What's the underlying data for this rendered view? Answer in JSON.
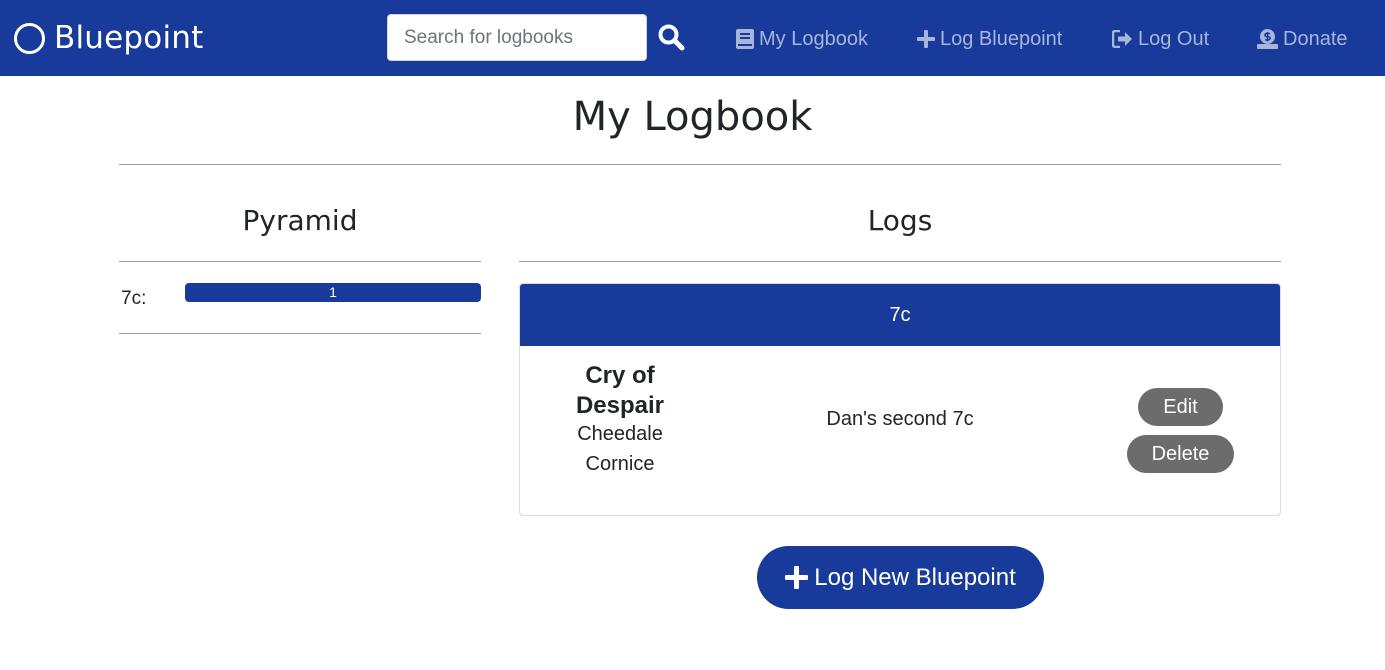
{
  "colors": {
    "brand": "#173a9b",
    "button_gray": "#6c6c6c",
    "nav_link": "#a9b5d8"
  },
  "navbar": {
    "brand": "Bluepoint",
    "brand_icon": "circle-icon",
    "search": {
      "placeholder": "Search for logbooks",
      "value": "",
      "icon": "search-icon"
    },
    "links": {
      "my_logbook": {
        "label": "My Logbook",
        "icon": "book-icon"
      },
      "log_bluepoint": {
        "label": "Log Bluepoint",
        "icon": "plus-icon"
      },
      "log_out": {
        "label": "Log Out",
        "icon": "sign-out-icon"
      },
      "donate": {
        "label": "Donate",
        "icon": "money-icon"
      }
    }
  },
  "page": {
    "title": "My Logbook"
  },
  "pyramid": {
    "title": "Pyramid",
    "rows": [
      {
        "grade": "7c:",
        "count": "1",
        "fill_fraction": 1.0
      }
    ]
  },
  "logs": {
    "title": "Logs",
    "groups": [
      {
        "grade": "7c",
        "entries": [
          {
            "route": "Cry of Despair",
            "crag": "Cheedale",
            "sector": "Cornice",
            "note": "Dan's second 7c",
            "edit_label": "Edit",
            "delete_label": "Delete"
          }
        ]
      }
    ],
    "new_button": {
      "label": "Log New Bluepoint",
      "icon": "plus-icon"
    }
  }
}
